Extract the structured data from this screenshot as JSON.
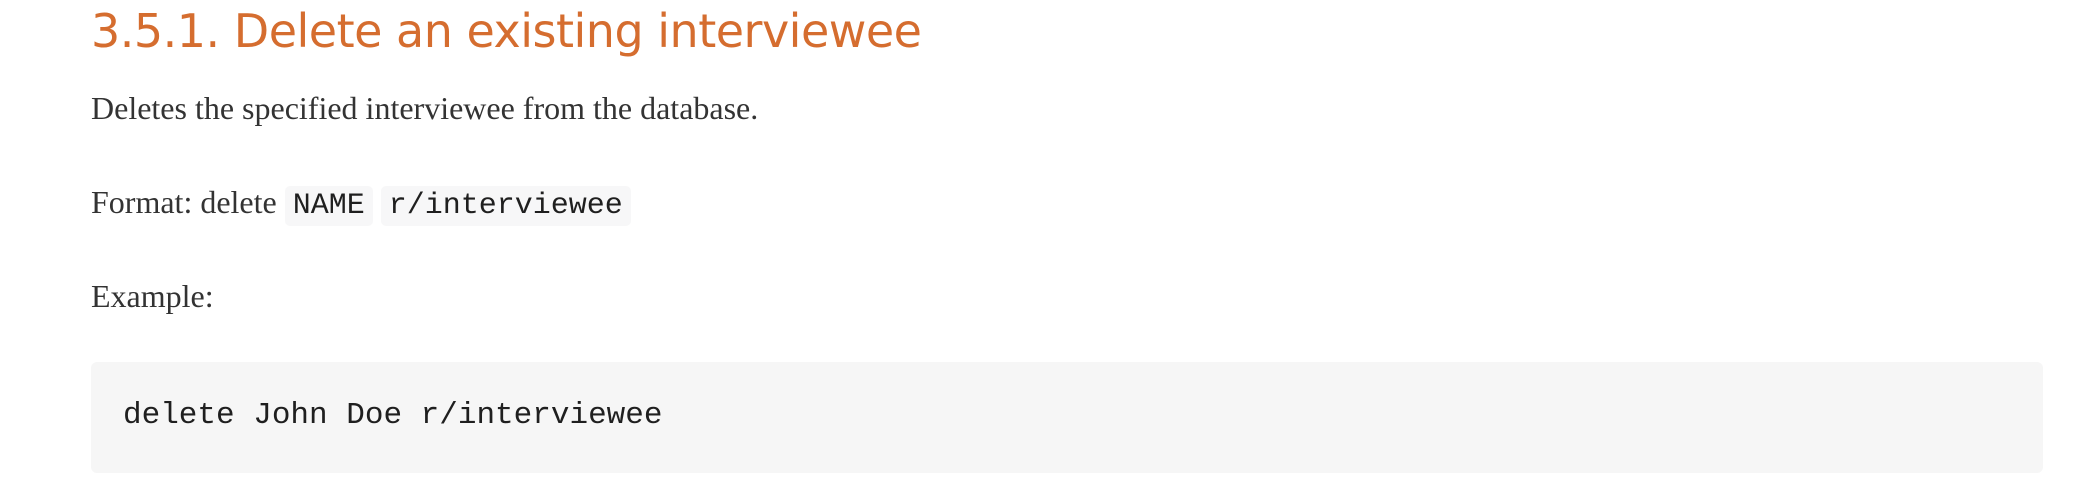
{
  "section": {
    "title": "3.5.1. Delete an existing interviewee",
    "description": "Deletes the specified interviewee from the database.",
    "format": {
      "prefix": "Format: delete ",
      "code_name": "NAME",
      "code_role": "r/interviewee"
    },
    "example_label": "Example:",
    "example_code": "delete John Doe r/interviewee"
  },
  "colors": {
    "heading": "#d56d2f",
    "body_text": "#333333",
    "code_background": "#f6f6f6"
  }
}
